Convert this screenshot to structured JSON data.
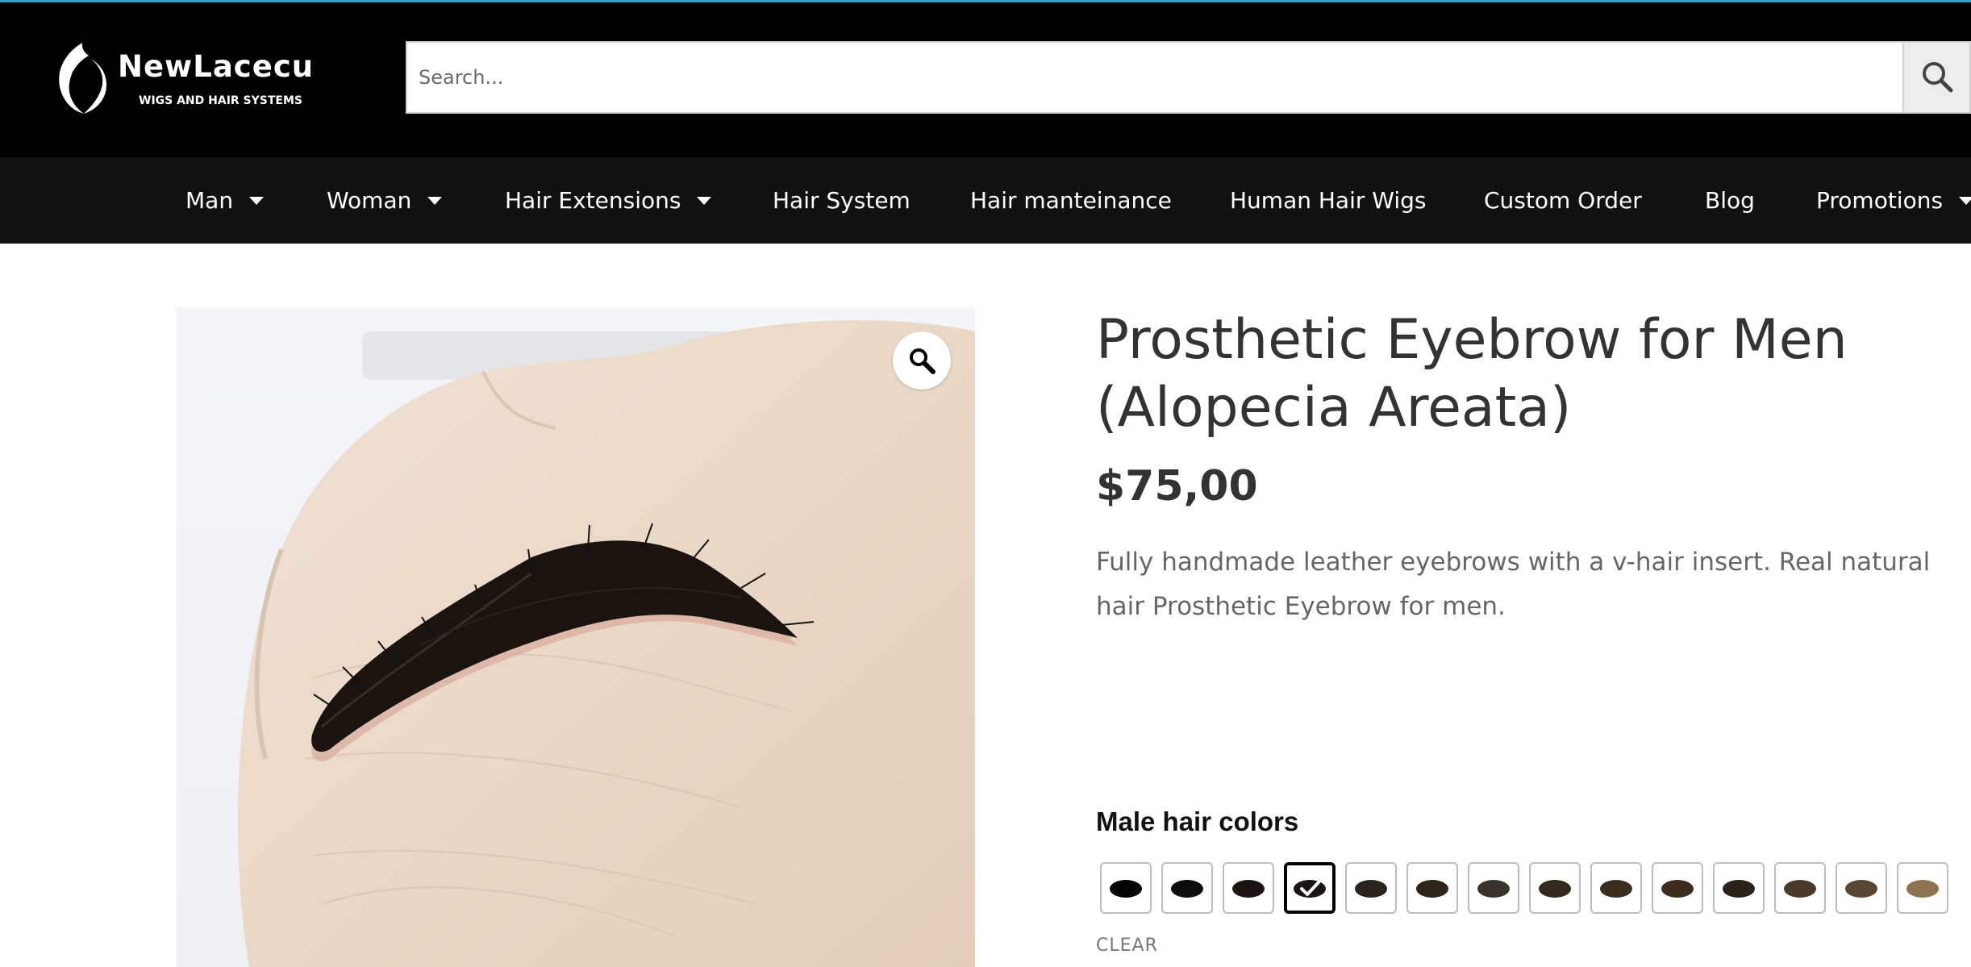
{
  "brand": {
    "name": "NewLacecu",
    "tagline": "WIGS AND HAIR SYSTEMS",
    "logo_icon": "woman-silhouette-logo"
  },
  "search": {
    "placeholder": "Search...",
    "button_icon": "search-icon"
  },
  "nav": {
    "items": [
      {
        "label": "Man",
        "has_dropdown": true
      },
      {
        "label": "Woman",
        "has_dropdown": true
      },
      {
        "label": "Hair Extensions",
        "has_dropdown": true
      },
      {
        "label": "Hair System",
        "has_dropdown": false
      },
      {
        "label": "Hair manteinance",
        "has_dropdown": false
      },
      {
        "label": "Human Hair Wigs",
        "has_dropdown": false
      },
      {
        "label": "Custom Order",
        "has_dropdown": false
      },
      {
        "label": "Blog",
        "has_dropdown": false
      },
      {
        "label": "Promotions",
        "has_dropdown": true
      }
    ]
  },
  "product": {
    "title": "Prosthetic Eyebrow for Men (Alopecia Areata)",
    "price": "$75,00",
    "description": "Fully handmade leather eyebrows with a v-hair insert. Real natural hair Prosthetic Eyebrow for men.",
    "zoom_icon": "magnifier-zoom-icon",
    "image_subject": "eyebrow-on-hand-photo"
  },
  "variation": {
    "label": "Male hair colors",
    "selected_index": 3,
    "swatch_colors": [
      "#050505",
      "#0d0b0a",
      "#1c1410",
      "#1a1512",
      "#2a221c",
      "#2e2419",
      "#3a332d",
      "#32291f",
      "#3a2d1d",
      "#3b2c1e",
      "#2a2119",
      "#4a3a28",
      "#5a4630",
      "#8c7250"
    ],
    "clear_label": "CLEAR"
  },
  "colors": {
    "accent_line": "#2fa4c4",
    "header_bg": "#000000",
    "nav_bg": "#111111"
  }
}
